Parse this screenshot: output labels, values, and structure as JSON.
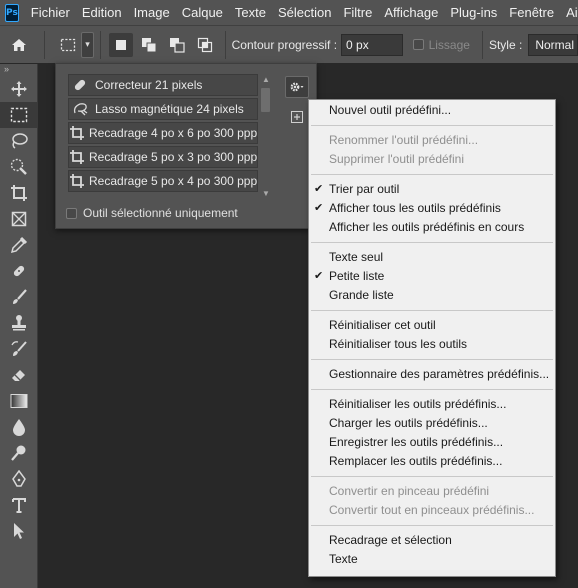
{
  "app": {
    "logo": "Ps"
  },
  "menubar": {
    "items": [
      "Fichier",
      "Edition",
      "Image",
      "Calque",
      "Texte",
      "Sélection",
      "Filtre",
      "Affichage",
      "Plug-ins",
      "Fenêtre",
      "Aide"
    ]
  },
  "options": {
    "feather_label": "Contour progressif :",
    "feather_value": "0 px",
    "antialias_label": "Lissage",
    "style_label": "Style :",
    "style_value": "Normal"
  },
  "toolbar": {
    "collapse": "»",
    "tools": [
      "move-icon",
      "marquee-icon",
      "lasso-icon",
      "quick-select-icon",
      "crop-icon",
      "frame-icon",
      "eyedropper-icon",
      "healing-icon",
      "brush-icon",
      "stamp-icon",
      "history-brush-icon",
      "eraser-icon",
      "gradient-icon",
      "blur-icon",
      "dodge-icon",
      "pen-icon",
      "type-icon",
      "path-select-icon"
    ],
    "active_tool": "marquee-icon"
  },
  "preset_panel": {
    "presets": [
      {
        "label": "Correcteur 21 pixels",
        "icon": "bandage-icon"
      },
      {
        "label": "Lasso magnétique 24 pixels",
        "icon": "magnetic-lasso-icon"
      },
      {
        "label": "Recadrage 4 po x 6 po 300 ppp",
        "icon": "crop-icon"
      },
      {
        "label": "Recadrage 5 po x 3 po 300 ppp",
        "icon": "crop-icon"
      },
      {
        "label": "Recadrage 5 po x 4 po 300 ppp",
        "icon": "crop-icon"
      }
    ],
    "current_tool_only_label": "Outil sélectionné uniquement"
  },
  "context_menu": {
    "items": [
      {
        "label": "Nouvel outil prédéfini...",
        "enabled": true,
        "checked": false
      },
      {
        "sep": true
      },
      {
        "label": "Renommer l'outil prédéfini...",
        "enabled": false,
        "checked": false
      },
      {
        "label": "Supprimer l'outil prédéfini",
        "enabled": false,
        "checked": false
      },
      {
        "sep": true
      },
      {
        "label": "Trier par outil",
        "enabled": true,
        "checked": true
      },
      {
        "label": "Afficher tous les outils prédéfinis",
        "enabled": true,
        "checked": true
      },
      {
        "label": "Afficher les outils prédéfinis en cours",
        "enabled": true,
        "checked": false
      },
      {
        "sep": true
      },
      {
        "label": "Texte seul",
        "enabled": true,
        "checked": false
      },
      {
        "label": "Petite liste",
        "enabled": true,
        "checked": true
      },
      {
        "label": "Grande liste",
        "enabled": true,
        "checked": false
      },
      {
        "sep": true
      },
      {
        "label": "Réinitialiser cet outil",
        "enabled": true,
        "checked": false
      },
      {
        "label": "Réinitialiser tous les outils",
        "enabled": true,
        "checked": false
      },
      {
        "sep": true
      },
      {
        "label": "Gestionnaire des paramètres prédéfinis...",
        "enabled": true,
        "checked": false
      },
      {
        "sep": true
      },
      {
        "label": "Réinitialiser les outils prédéfinis...",
        "enabled": true,
        "checked": false
      },
      {
        "label": "Charger les outils prédéfinis...",
        "enabled": true,
        "checked": false
      },
      {
        "label": "Enregistrer les outils prédéfinis...",
        "enabled": true,
        "checked": false
      },
      {
        "label": "Remplacer les outils prédéfinis...",
        "enabled": true,
        "checked": false
      },
      {
        "sep": true
      },
      {
        "label": "Convertir en pinceau prédéfini",
        "enabled": false,
        "checked": false
      },
      {
        "label": "Convertir tout en pinceaux prédéfinis...",
        "enabled": false,
        "checked": false
      },
      {
        "sep": true
      },
      {
        "label": "Recadrage et sélection",
        "enabled": true,
        "checked": false
      },
      {
        "label": "Texte",
        "enabled": true,
        "checked": false
      }
    ],
    "check_glyph": "✔"
  }
}
